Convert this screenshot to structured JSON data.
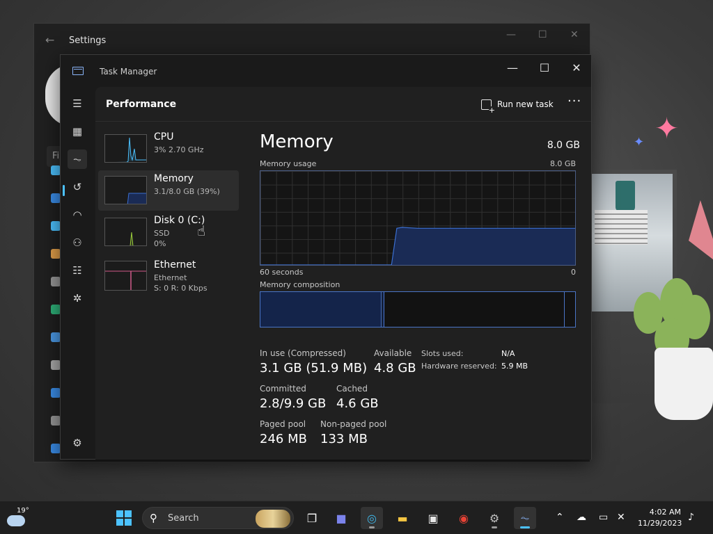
{
  "settings_window": {
    "title": "Settings",
    "search_partial": "Fi"
  },
  "task_manager": {
    "title": "Task Manager",
    "page_title": "Performance",
    "run_new_task": "Run new task",
    "more": "···",
    "performance_items": [
      {
        "name": "CPU",
        "line1": "3% 2.70 GHz",
        "line2": ""
      },
      {
        "name": "Memory",
        "line1": "3.1/8.0 GB (39%)",
        "line2": ""
      },
      {
        "name": "Disk 0 (C:)",
        "line1": "SSD",
        "line2": "0%"
      },
      {
        "name": "Ethernet",
        "line1": "Ethernet",
        "line2": "S: 0 R: 0 Kbps"
      }
    ],
    "memory": {
      "title": "Memory",
      "total": "8.0 GB",
      "usage_label": "Memory usage",
      "usage_max": "8.0 GB",
      "time_span": "60 seconds",
      "time_end": "0",
      "composition_label": "Memory composition",
      "stats": {
        "in_use_label": "In use (Compressed)",
        "in_use_value": "3.1 GB (51.9 MB)",
        "available_label": "Available",
        "available_value": "4.8 GB",
        "committed_label": "Committed",
        "committed_value": "2.8/9.9 GB",
        "cached_label": "Cached",
        "cached_value": "4.6 GB",
        "paged_label": "Paged pool",
        "paged_value": "246 MB",
        "nonpaged_label": "Non-paged pool",
        "nonpaged_value": "133 MB",
        "slots_label": "Slots used:",
        "slots_value": "N/A",
        "hw_reserved_label": "Hardware reserved:",
        "hw_reserved_value": "5.9 MB"
      }
    }
  },
  "chart_data": {
    "type": "area",
    "x": [
      60,
      45,
      40,
      35,
      34,
      33,
      30,
      20,
      10,
      0
    ],
    "values": [
      0,
      0,
      0,
      0,
      39,
      40,
      39,
      39,
      39,
      39
    ],
    "xlabel": "60 seconds",
    "ylim": [
      0,
      100
    ]
  },
  "taskbar": {
    "weather_temp": "19°",
    "search_label": "Search",
    "time": "4:02 AM",
    "date": "11/29/2023"
  },
  "colors": {
    "accent": "#4cc2ff",
    "memory_line": "#3b6fd1",
    "memory_fill": "#1a2b55"
  }
}
